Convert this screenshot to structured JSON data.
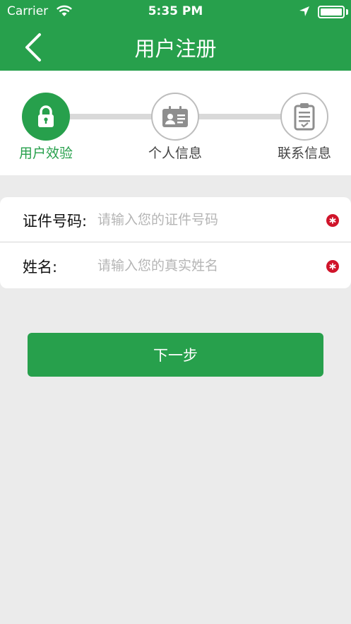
{
  "status_bar": {
    "carrier": "Carrier",
    "time": "5:35 PM"
  },
  "header": {
    "title": "用户注册",
    "back_icon": "chevron-left-icon"
  },
  "steps": [
    {
      "label": "用户效验",
      "icon": "lock-icon",
      "state": "active"
    },
    {
      "label": "个人信息",
      "icon": "id-card-icon",
      "state": "inactive"
    },
    {
      "label": "联系信息",
      "icon": "clipboard-icon",
      "state": "inactive"
    }
  ],
  "form": {
    "id_number": {
      "label": "证件号码:",
      "placeholder": "请输入您的证件号码",
      "value": ""
    },
    "name": {
      "label": "姓名:",
      "placeholder": "请输入您的真实姓名",
      "value": ""
    }
  },
  "next_button": {
    "label": "下一步"
  },
  "colors": {
    "brand_green": "#27a04c",
    "required_red": "#d0142a",
    "background": "#ebebeb"
  }
}
